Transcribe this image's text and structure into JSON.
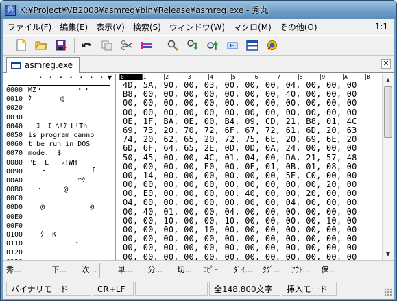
{
  "window": {
    "title": "K:¥Project¥VB2008¥asmreg¥bin¥Release¥asmreg.exe - 秀丸",
    "app_icon_glyph": "秀"
  },
  "menubar": {
    "items": [
      "ファイル(F)",
      "編集(E)",
      "表示(V)",
      "検索(S)",
      "ウィンドウ(W)",
      "マクロ(M)",
      "その他(O)"
    ],
    "position": "1:1"
  },
  "toolbar": {
    "buttons": [
      "new-file-icon",
      "open-folder-icon",
      "save-icon",
      "undo-icon",
      "copy-icon",
      "cut-icon",
      "paste-icon",
      "search-icon",
      "search-down-icon",
      "search-up-icon",
      "return-icon",
      "split-window-icon",
      "help-icon"
    ]
  },
  "tabs": [
    {
      "label": "asmreg.exe"
    }
  ],
  "left_pane": {
    "header_dots": "• • • • • • •",
    "lines": [
      {
        "addr": "0000",
        "text": "MZ・        ・・"
      },
      {
        "addr": "0010",
        "text": "ｸ       @"
      },
      {
        "addr": "0020",
        "text": ""
      },
      {
        "addr": "0030",
        "text": ""
      },
      {
        "addr": "0040",
        "text": "  ｺ  ｴ ﾍ!ｸ L!Th"
      },
      {
        "addr": "0050",
        "text": "is program canno"
      },
      {
        "addr": "0060",
        "text": "t be run in DOS"
      },
      {
        "addr": "0070",
        "text": "mode.  $"
      },
      {
        "addr": "0080",
        "text": "PE  L   ﾚ!WH"
      },
      {
        "addr": "0090",
        "text": "   ・          「"
      },
      {
        "addr": "00A0",
        "text": "            ^ｸ"
      },
      {
        "addr": "00B0",
        "text": "  ・     @"
      },
      {
        "addr": "00C0",
        "text": ""
      },
      {
        "addr": "00D0",
        "text": "   @           @"
      },
      {
        "addr": "00E0",
        "text": ""
      },
      {
        "addr": "00F0",
        "text": ""
      },
      {
        "addr": "0100",
        "text": "   ｸ  K"
      },
      {
        "addr": "0110",
        "text": "           ・"
      },
      {
        "addr": "0120",
        "text": ""
      },
      {
        "addr": "0130",
        "text": ""
      }
    ]
  },
  "hex_pane": {
    "ruler": [
      "0",
      "1",
      "2",
      "3",
      "4",
      "5",
      "6",
      "7",
      "8",
      "9",
      "A",
      "B"
    ],
    "current_column": "0",
    "rows": [
      "4D, 5A, 90, 00, 03, 00, 00, 00, 04, 00, 00, 00",
      "B8, 00, 00, 00, 00, 00, 00, 00, 40, 00, 00, 00",
      "00, 00, 00, 00, 00, 00, 00, 00, 00, 00, 00, 00",
      "00, 00, 00, 00, 00, 00, 00, 00, 00, 00, 00, 00",
      "0E, 1F, BA, 0E, 00, B4, 09, CD, 21, B8, 01, 4C",
      "69, 73, 20, 70, 72, 6F, 67, 72, 61, 6D, 20, 63",
      "74, 20, 62, 65, 20, 72, 75, 6E, 20, 69, 6E, 20",
      "6D, 6F, 64, 65, 2E, 0D, 0D, 0A, 24, 00, 00, 00",
      "50, 45, 00, 00, 4C, 01, 04, 00, DA, 21, 57, 48",
      "00, 00, 00, 00, E0, 00, 0E, 01, 0B, 01, 08, 00",
      "00, 14, 00, 00, 00, 00, 00, 00, 5E, C0, 00, 00",
      "00, 00, 00, 00, 00, 00, 00, 00, 00, 00, 20, 00",
      "00, E0, 00, 00, 00, 00, 40, 00, 00, 20, 00, 00",
      "04, 00, 00, 00, 00, 00, 00, 00, 04, 00, 00, 00",
      "00, 40, 01, 00, 00, 04, 00, 00, 00, 00, 00, 00",
      "00, 00, 10, 00, 00, 10, 00, 00, 00, 00, 10, 00",
      "00, 00, 00, 00, 10, 00, 00, 00, 00, 00, 00, 00",
      "00, 00, 00, 00, 00, 00, 00, 00, 00, 00, 00, 00",
      "00, 00, 00, 00, 00, 00, 00, 00, 00, 00, 00, 00",
      "00, 00, 00, 00, 00, 00, 00, 00, 00, 00, 00, 00"
    ]
  },
  "function_keys": [
    "秀...",
    "下...",
    "次...",
    "単...",
    "分...",
    "切...",
    "ｺﾋﾟｰ",
    "ﾀﾞｲ...",
    "ﾀｸﾞ...",
    "ｱｳﾄ...",
    "保..."
  ],
  "statusbar": {
    "mode": "バイナリモード",
    "newline": "CR+LF",
    "chars": "全148,800文字",
    "input_mode": "挿入モード"
  }
}
